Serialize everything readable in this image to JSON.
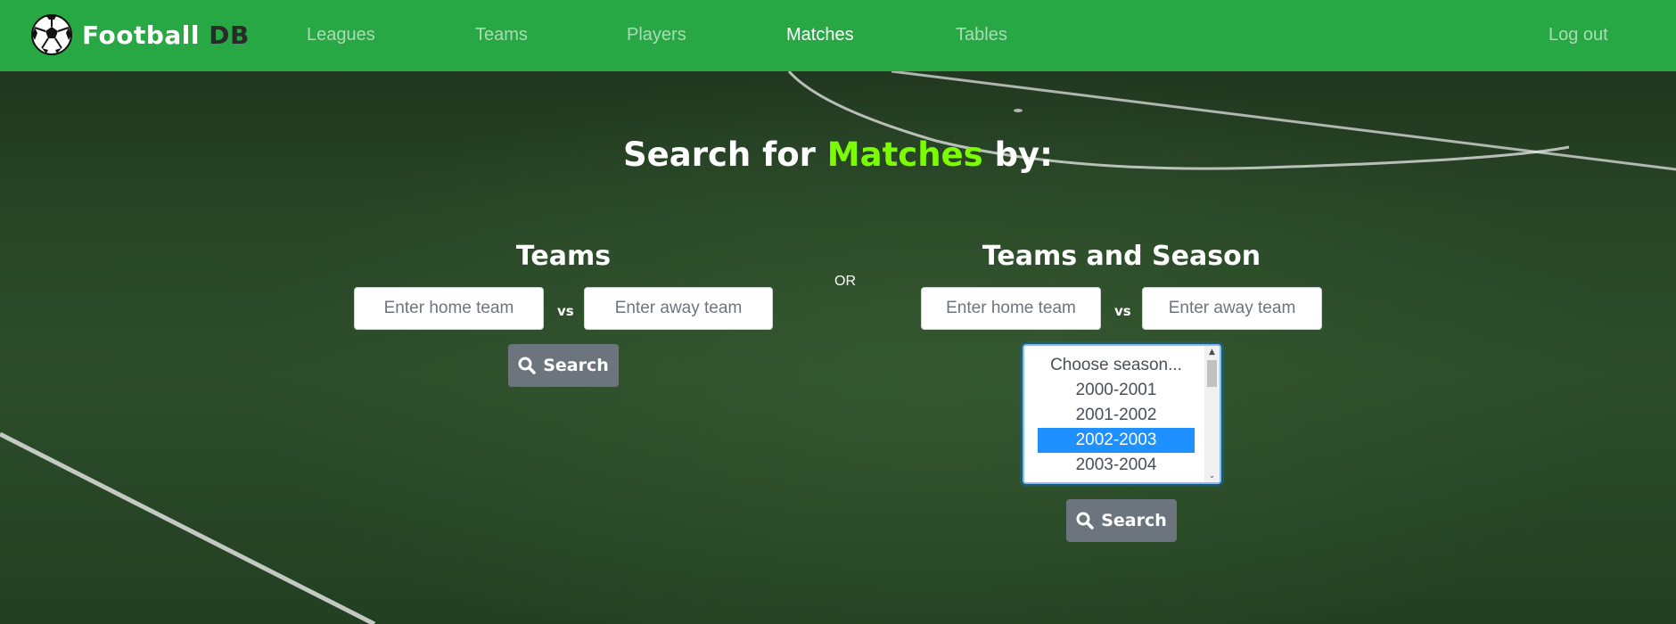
{
  "brand": {
    "name": "Football",
    "suffix": "DB"
  },
  "nav": {
    "items": [
      "Leagues",
      "Teams",
      "Players",
      "Matches",
      "Tables"
    ],
    "active": "Matches",
    "logout": "Log out"
  },
  "heading": {
    "prefix": "Search for",
    "highlight": "Matches",
    "suffix": "by:"
  },
  "teams_form": {
    "title": "Teams",
    "home_placeholder": "Enter home team",
    "away_placeholder": "Enter away team",
    "vs": "vs",
    "search_label": "Search"
  },
  "separator": "OR",
  "season_form": {
    "title": "Teams and Season",
    "home_placeholder": "Enter home team",
    "away_placeholder": "Enter away team",
    "vs": "vs",
    "season_options": [
      "Choose season...",
      "2000-2001",
      "2001-2002",
      "2002-2003",
      "2003-2004"
    ],
    "selected_season": "2002-2003",
    "search_label": "Search"
  },
  "colors": {
    "navbar": "#28a745",
    "highlight": "#7cfc00",
    "button": "#6c757d",
    "selected_option": "#1e90ff"
  },
  "icons": {
    "logo": "soccer-ball-icon",
    "search": "magnifier-icon"
  }
}
